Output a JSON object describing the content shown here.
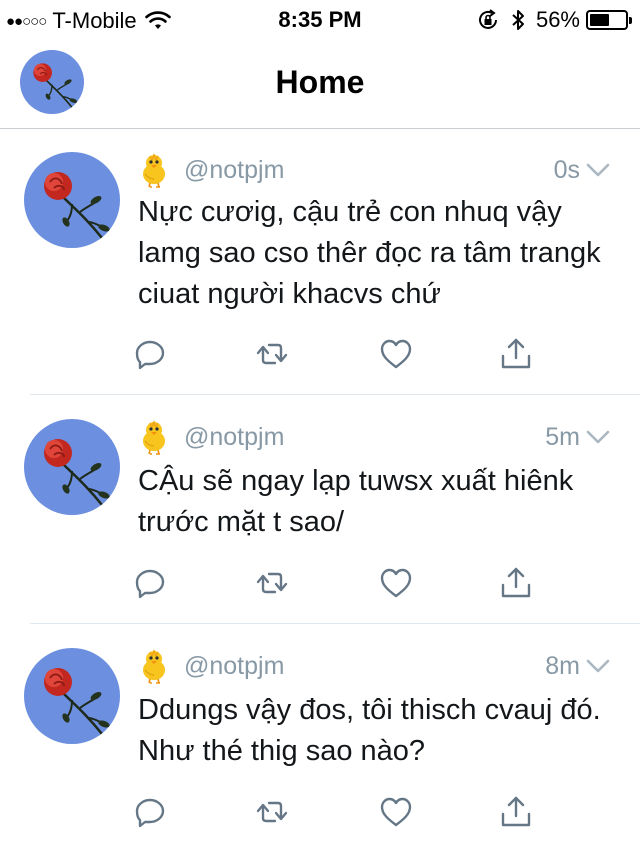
{
  "status_bar": {
    "signal": "●●○○○",
    "carrier": "T-Mobile",
    "time": "8:35 PM",
    "battery_percent": "56%",
    "battery_level": 0.56
  },
  "nav": {
    "title": "Home"
  },
  "tweets": [
    {
      "handle": "@notpjm",
      "time": "0s",
      "text": "Nực cươig, cậu trẻ con nhuq vậy lamg sao cso thêr đọc ra tâm trangk ciuat người khacvs chứ"
    },
    {
      "handle": "@notpjm",
      "time": "5m",
      "text": "CẬu sẽ ngay lạp tuwsx xuất hiênk trước mặt t sao/"
    },
    {
      "handle": "@notpjm",
      "time": "8m",
      "text": "Ddungs vậy đos, tôi thisch cvauj đó. Như thé thig sao nào?"
    }
  ],
  "colors": {
    "accent": "#1da1f2",
    "muted": "#8899a6",
    "icon": "#657786",
    "avatar_sky": "#6d8fe0",
    "rose": "#d7322a"
  },
  "icons": [
    "wifi-icon",
    "rotation-lock-icon",
    "bluetooth-icon",
    "chick-emoji-icon",
    "chevron-down-icon",
    "reply-icon",
    "retweet-icon",
    "like-icon",
    "share-icon"
  ]
}
